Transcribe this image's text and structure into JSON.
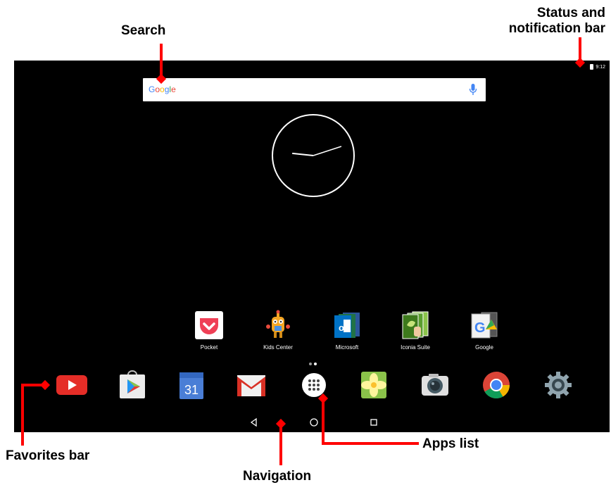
{
  "callouts": {
    "search": "Search",
    "status_line1": "Status and",
    "status_line2": "notification bar",
    "favorites": "Favorites bar",
    "navigation": "Navigation",
    "apps_list": "Apps  list"
  },
  "status_bar": {
    "time": "9:12"
  },
  "search_bar": {
    "logo": "Google"
  },
  "clock": {
    "hour": 9,
    "minute": 12
  },
  "home_apps": [
    {
      "label": "Pocket",
      "icon": "pocket-icon"
    },
    {
      "label": "Kids Center",
      "icon": "kids-center-icon"
    },
    {
      "label": "Microsoft",
      "icon": "microsoft-folder-icon"
    },
    {
      "label": "Iconia Suite",
      "icon": "iconia-suite-icon"
    },
    {
      "label": "Google",
      "icon": "google-folder-icon"
    }
  ],
  "favorites_bar": [
    {
      "icon": "youtube-icon"
    },
    {
      "icon": "play-store-icon"
    },
    {
      "icon": "calendar-icon",
      "text": "31"
    },
    {
      "icon": "gmail-icon"
    },
    {
      "icon": "apps-list-icon"
    },
    {
      "icon": "gallery-icon"
    },
    {
      "icon": "camera-icon"
    },
    {
      "icon": "chrome-icon"
    },
    {
      "icon": "settings-icon"
    }
  ],
  "navigation": [
    "back-icon",
    "home-icon",
    "recents-icon"
  ],
  "colors": {
    "callout_red": "#ff0000",
    "screen_bg": "#000000"
  }
}
